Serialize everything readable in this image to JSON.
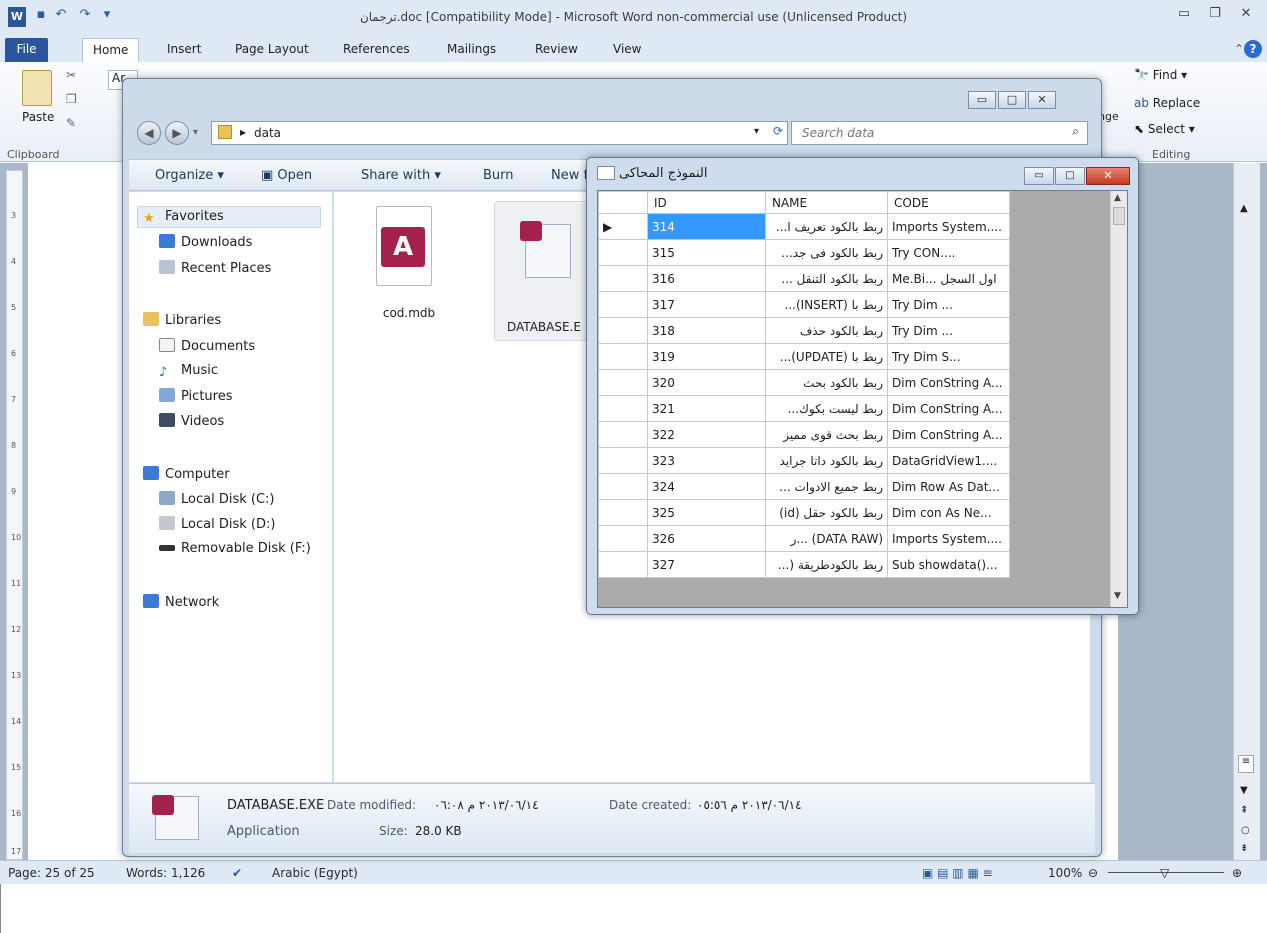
{
  "word": {
    "title": "ترجمان.doc [Compatibility Mode]  -  Microsoft Word non-commercial use (Unlicensed Product)",
    "tabs": [
      "File",
      "Home",
      "Insert",
      "Page Layout",
      "References",
      "Mailings",
      "Review",
      "View"
    ],
    "ribbon": {
      "paste": "Paste",
      "clipboard": "Clipboard",
      "font_box": "Ar",
      "find": "Find",
      "replace": "Replace",
      "select": "Select",
      "editing": "Editing",
      "change_styles_1": "nge",
      "change_styles_2": "s"
    },
    "ruler_numbers": [
      "3",
      "4",
      "5",
      "6",
      "7",
      "8",
      "9",
      "10",
      "11",
      "12",
      "13",
      "14",
      "15",
      "16",
      "17"
    ],
    "status": {
      "page": "Page: 25 of 25",
      "words": "Words: 1,126",
      "language": "Arabic (Egypt)",
      "zoom": "100%"
    }
  },
  "explorer": {
    "breadcrumb": "data",
    "search_placeholder": "Search data",
    "toolbar": {
      "organize": "Organize",
      "open": "Open",
      "share": "Share with",
      "burn": "Burn",
      "new": "New f"
    },
    "nav": {
      "favorites": "Favorites",
      "downloads": "Downloads",
      "recent": "Recent Places",
      "libraries": "Libraries",
      "documents": "Documents",
      "music": "Music",
      "pictures": "Pictures",
      "videos": "Videos",
      "computer": "Computer",
      "disk_c": "Local Disk (C:)",
      "disk_d": "Local Disk (D:)",
      "disk_f": "Removable Disk (F:)",
      "network": "Network"
    },
    "files": [
      {
        "name": "cod.mdb"
      },
      {
        "name": "DATABASE.E"
      }
    ],
    "details": {
      "name": "DATABASE.EXE",
      "modified_label": "Date modified:",
      "modified": "٢٠١٣/٠٦/١٤ م ٠٦:٠٨",
      "created_label": "Date created:",
      "created": "٢٠١٣/٠٦/١٤ م ٠٥:٥٦",
      "type": "Application",
      "size_label": "Size:",
      "size": "28.0 KB"
    }
  },
  "form": {
    "title": "النموذج المحاكى",
    "columns": [
      "ID",
      "NAME",
      "CODE"
    ],
    "rows": [
      {
        "id": "314",
        "name": "ربط بالكود تعريف ا...",
        "code": "Imports System...."
      },
      {
        "id": "315",
        "name": "ربط بالكود فى جد...",
        "code": "Try      CON...."
      },
      {
        "id": "316",
        "name": "ربط بالكود التنقل ...",
        "code": "Me.Bi... اول السجل"
      },
      {
        "id": "317",
        "name": "ربط با (INSERT)...",
        "code": "Try       Dim ..."
      },
      {
        "id": "318",
        "name": "ربط بالكود حذف",
        "code": "Try       Dim ..."
      },
      {
        "id": "319",
        "name": "ربط با (UPDATE)...",
        "code": "Try      Dim S..."
      },
      {
        "id": "320",
        "name": "ربط بالكود بحث",
        "code": "Dim ConString A..."
      },
      {
        "id": "321",
        "name": "ربط ليست بكوك...",
        "code": "Dim ConString A..."
      },
      {
        "id": "322",
        "name": "ربط بحث قوى مميز",
        "code": "Dim ConString A..."
      },
      {
        "id": "323",
        "name": "ربط بالكود داتا جرايد",
        "code": "DataGridView1...."
      },
      {
        "id": "324",
        "name": "ربط جميع الادوات ...",
        "code": "Dim Row As Dat..."
      },
      {
        "id": "325",
        "name": "ربط بالكود حقل (id)",
        "code": "Dim con As Ne..."
      },
      {
        "id": "326",
        "name": "(DATA RAW) ...ر",
        "code": "Imports System...."
      },
      {
        "id": "327",
        "name": "ربط بالكودطريقة (...",
        "code": "Sub showdata()..."
      }
    ]
  }
}
